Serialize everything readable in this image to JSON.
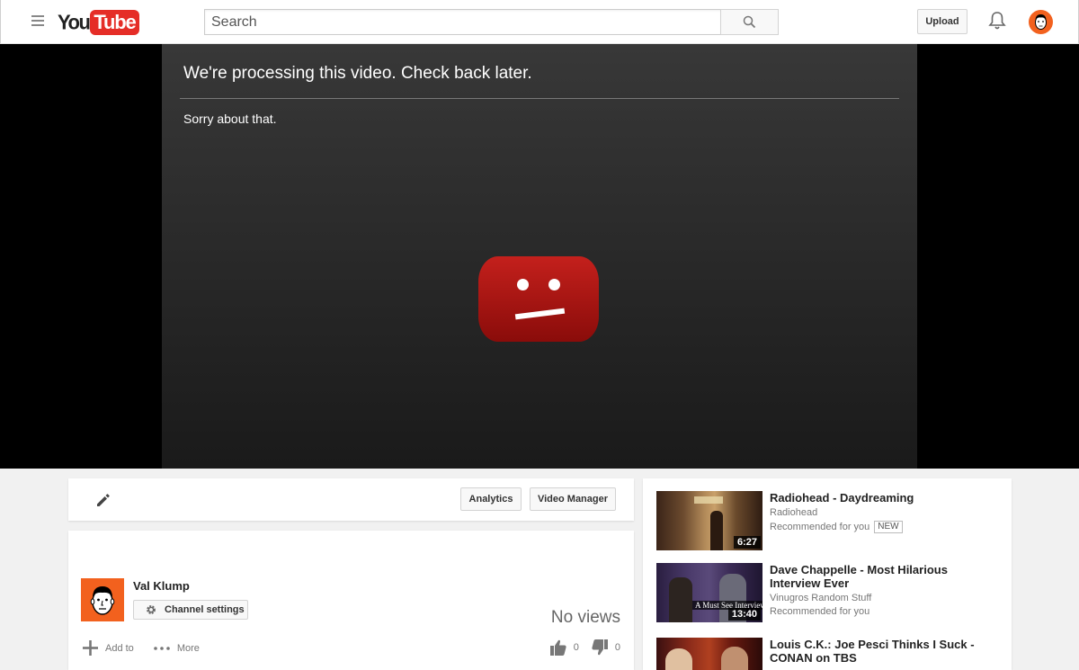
{
  "header": {
    "logo_you": "You",
    "logo_tube": "Tube",
    "search_placeholder": "Search",
    "upload_label": "Upload"
  },
  "player": {
    "message": "We're processing this video. Check back later.",
    "submessage": "Sorry about that."
  },
  "owner_actions": {
    "analytics_label": "Analytics",
    "video_manager_label": "Video Manager"
  },
  "video_info": {
    "channel_name": "Val Klump",
    "channel_settings_label": "Channel settings",
    "views": "No views",
    "add_to_label": "Add to",
    "more_label": "More",
    "likes": "0",
    "dislikes": "0"
  },
  "recommendations": [
    {
      "title": "Radiohead - Daydreaming",
      "channel": "Radiohead",
      "note": "Recommended for you",
      "badge": "NEW",
      "duration": "6:27"
    },
    {
      "title": "Dave Chappelle - Most Hilarious Interview Ever",
      "channel": "Vinugros Random Stuff",
      "note": "Recommended for you",
      "duration": "13:40",
      "thumb_caption": "A Must See Interview"
    },
    {
      "title": "Louis C.K.: Joe Pesci Thinks I Suck - CONAN on TBS"
    }
  ],
  "colors": {
    "brand_red": "#e52d27",
    "avatar_orange": "#f2611e"
  }
}
